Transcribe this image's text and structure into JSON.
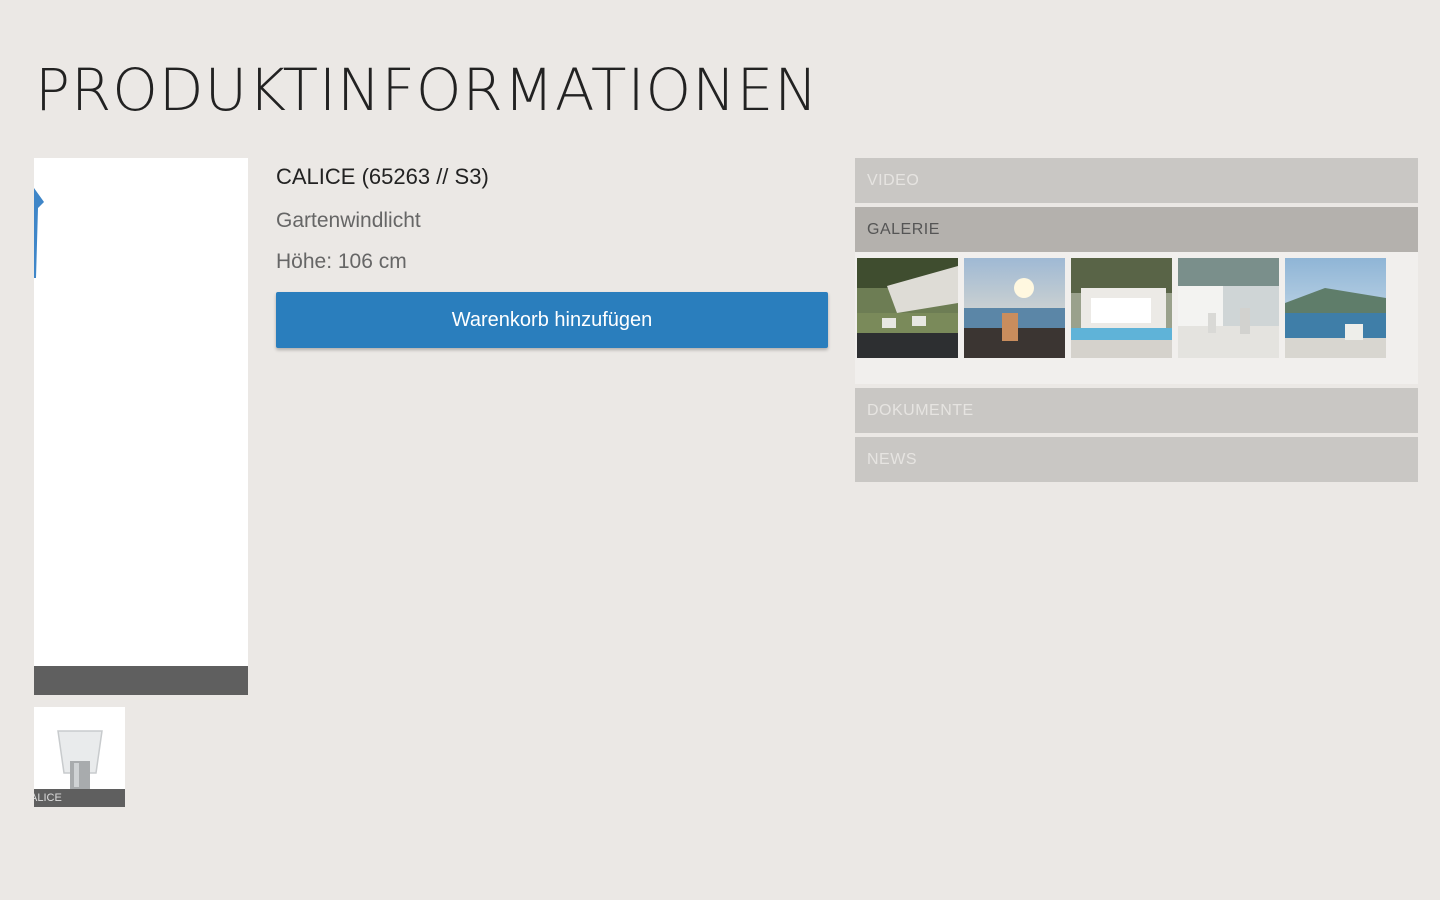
{
  "page": {
    "title": "PRODUKTINFORMATIONEN"
  },
  "product": {
    "name": "CALICE (65263 // S3)",
    "category": "Gartenwindlicht",
    "height": "Höhe: 106 cm",
    "cart_button_label": "Warenkorb hinzufügen",
    "thumbnail_caption": "ALICE"
  },
  "accordion": {
    "sections": [
      {
        "label": "VIDEO",
        "expanded": false
      },
      {
        "label": "GALERIE",
        "expanded": true
      },
      {
        "label": "DOKUMENTE",
        "expanded": false
      },
      {
        "label": "NEWS",
        "expanded": false
      }
    ]
  },
  "gallery": {
    "images": [
      "garden-terrace-photo",
      "seaside-sunset-photo",
      "poolside-villa-photo",
      "white-patio-photo",
      "lake-terrace-photo"
    ]
  },
  "colors": {
    "background": "#ebe8e5",
    "accent_button": "#2a7ebd",
    "header_inactive": "#c9c7c4",
    "header_active": "#b4b1ad"
  }
}
